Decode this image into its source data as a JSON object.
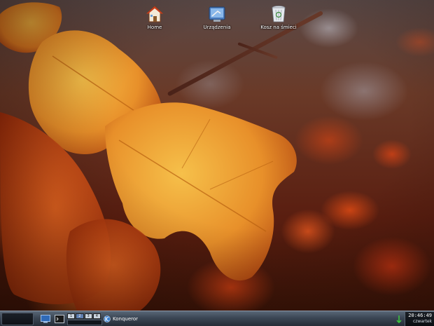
{
  "desktop": {
    "icons": [
      {
        "label": "Home",
        "icon": "home-icon"
      },
      {
        "label": "Urządzenia",
        "icon": "devices-icon"
      },
      {
        "label": "Kosz na śmieci",
        "icon": "trash-icon"
      }
    ]
  },
  "taskbar": {
    "pager": [
      "1",
      "2",
      "3",
      "4"
    ],
    "active_desktop": 1,
    "task": {
      "label": "Konqueror",
      "icon": "konqueror-icon"
    },
    "clock": {
      "time": "20:46:49",
      "day": "czwartek"
    }
  },
  "colors": {
    "taskbar_top": "#596777",
    "taskbar_bottom": "#262d37",
    "leaf_orange": "#e8902a",
    "pager_active": "#5f7fb0"
  }
}
